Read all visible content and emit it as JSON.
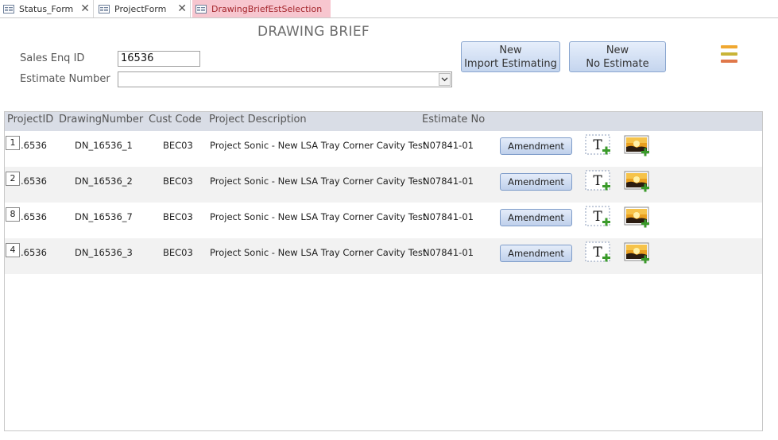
{
  "tabs": [
    {
      "label": "Status_Form"
    },
    {
      "label": "ProjectForm"
    },
    {
      "label": "DrawingBriefEstSelection"
    }
  ],
  "form": {
    "title": "DRAWING BRIEF",
    "sales_enq_label": "Sales Enq ID",
    "sales_enq_value": "16536",
    "estimate_label": "Estimate Number",
    "estimate_value": ""
  },
  "buttons": {
    "new_import_line1": "New",
    "new_import_line2": "Import Estimating",
    "new_noest_line1": "New",
    "new_noest_line2": "No Estimate"
  },
  "colors": {
    "menu_icon": [
      "#f0a830",
      "#c9b437",
      "#e0784a"
    ],
    "active_tab_bg": "#f7c6cf"
  },
  "table": {
    "headers": [
      "ProjectID",
      "DrawingNumber",
      "Cust Code",
      "Project Description",
      "Estimate No"
    ],
    "rows": [
      {
        "sel": "1",
        "project_id": ".6536",
        "drawing_number": "DN_16536_1",
        "cust_code": "BEC03",
        "description": "Project Sonic - New LSA Tray Corner Cavity Test",
        "estimate_no": "N07841-01",
        "action": "Amendment"
      },
      {
        "sel": "2",
        "project_id": ".6536",
        "drawing_number": "DN_16536_2",
        "cust_code": "BEC03",
        "description": "Project Sonic - New LSA Tray Corner Cavity Test",
        "estimate_no": "N07841-01",
        "action": "Amendment"
      },
      {
        "sel": "8",
        "project_id": ".6536",
        "drawing_number": "DN_16536_7",
        "cust_code": "BEC03",
        "description": "Project Sonic - New LSA Tray Corner Cavity Test",
        "estimate_no": "N07841-01",
        "action": "Amendment"
      },
      {
        "sel": "4",
        "project_id": ".6536",
        "drawing_number": "DN_16536_3",
        "cust_code": "BEC03",
        "description": "Project Sonic - New LSA Tray Corner Cavity Test",
        "estimate_no": "N07841-01",
        "action": "Amendment"
      }
    ]
  }
}
